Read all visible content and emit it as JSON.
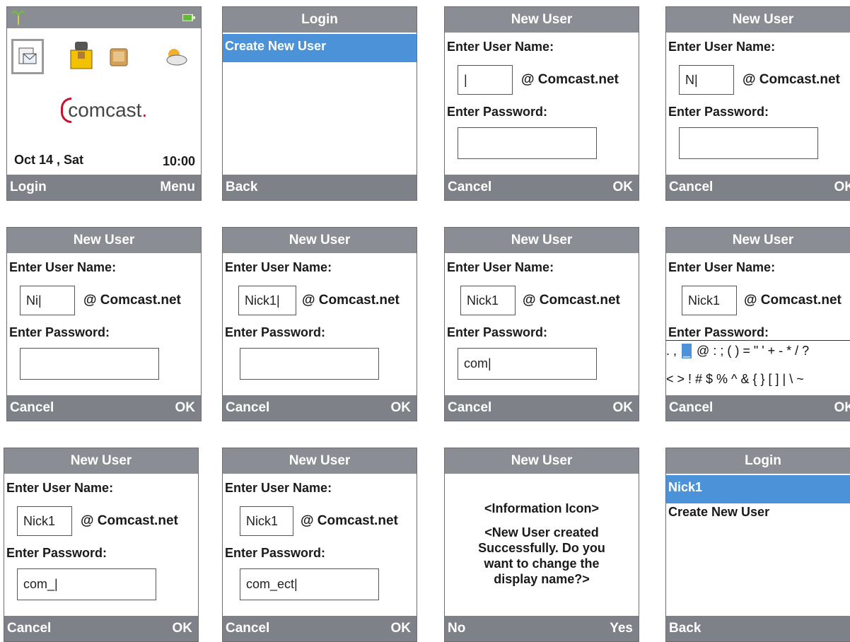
{
  "s1": {
    "date": "Oct 14 , Sat",
    "time": "10:00",
    "brand": "comcast",
    "brand_dot": ".",
    "left": "Login",
    "right": "Menu"
  },
  "s2": {
    "title": "Login",
    "item": "Create New User",
    "left": "Back"
  },
  "s3": {
    "title": "New User",
    "user_label": "Enter User Name:",
    "user_value": "|",
    "domain": "@ Comcast.net",
    "pass_label": "Enter Password:",
    "pass_value": "",
    "left": "Cancel",
    "right": "OK"
  },
  "s4": {
    "title": "New User",
    "user_label": "Enter User Name:",
    "user_value": "N|",
    "domain": "@ Comcast.net",
    "pass_label": "Enter Password:",
    "pass_value": "",
    "left": "Cancel",
    "right": "OK"
  },
  "s5": {
    "title": "New User",
    "user_label": "Enter User Name:",
    "user_value": "Ni|",
    "domain": "@ Comcast.net",
    "pass_label": "Enter Password:",
    "pass_value": "",
    "left": "Cancel",
    "right": "OK"
  },
  "s6": {
    "title": "New User",
    "user_label": "Enter User Name:",
    "user_value": "Nick1|",
    "domain": "@ Comcast.net",
    "pass_label": "Enter Password:",
    "pass_value": "",
    "left": "Cancel",
    "right": "OK"
  },
  "s7": {
    "title": "New User",
    "user_label": "Enter User Name:",
    "user_value": "Nick1",
    "domain": "@ Comcast.net",
    "pass_label": "Enter Password:",
    "pass_value": "com|",
    "left": "Cancel",
    "right": "OK"
  },
  "s8": {
    "title": "New User",
    "user_label": "Enter User Name:",
    "user_value": "Nick1",
    "domain": "@ Comcast.net",
    "pass_label": "Enter Password:",
    "sym_pre": ". ,",
    "sym_sel": "_",
    "sym_row1": "@ : ; ( ) = \" ' + - * / ?",
    "sym_row2": "< > ! # $ % ^ & { } [ ] | \\ ~",
    "left": "Cancel",
    "right": "OK"
  },
  "s9": {
    "title": "New User",
    "user_label": "Enter User Name:",
    "user_value": "Nick1",
    "domain": "@ Comcast.net",
    "pass_label": "Enter Password:",
    "pass_value": "com_|",
    "left": "Cancel",
    "right": "OK"
  },
  "s10": {
    "title": "New User",
    "user_label": "Enter User Name:",
    "user_value": "Nick1",
    "domain": "@ Comcast.net",
    "pass_label": "Enter Password:",
    "pass_value": "com_ect|",
    "left": "Cancel",
    "right": "OK"
  },
  "s11": {
    "title": "New User",
    "line1": "<Information Icon>",
    "line2": "<New User created",
    "line3": "Successfully. Do you",
    "line4": "want to change the",
    "line5": "display name?>",
    "left": "No",
    "right": "Yes"
  },
  "s12": {
    "title": "Login",
    "item_selected": "Nick1",
    "item2": "Create New User",
    "left": "Back"
  },
  "colors": {
    "title_bar": "#8a8d93",
    "soft_bar": "#7e8188",
    "selection": "#4c92d9",
    "brand_red": "#c8102e"
  },
  "icons": [
    "signal-icon",
    "battery-icon",
    "mail-icon",
    "phonebook-icon",
    "notes-icon",
    "weather-icon"
  ]
}
